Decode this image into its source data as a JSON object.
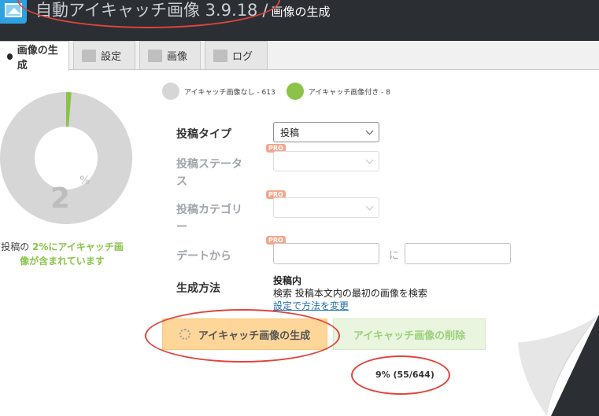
{
  "header": {
    "app_title": "自動アイキャッチ画像 3.9.18",
    "separator": "/",
    "page_name": "画像の生成"
  },
  "tabs": [
    {
      "label": "画像の生成",
      "icon": "dot-icon",
      "active": true
    },
    {
      "label": "設定",
      "icon": "settings-icon",
      "active": false
    },
    {
      "label": "画像",
      "icon": "image-icon",
      "active": false
    },
    {
      "label": "ログ",
      "icon": "log-icon",
      "active": false
    }
  ],
  "chart_data": {
    "type": "pie",
    "categories": [
      "アイキャッチ画像なし",
      "アイキャッチ画像付き"
    ],
    "values": [
      613,
      8
    ],
    "colors": [
      "#d6d6d6",
      "#8bc34a"
    ]
  },
  "donut_center": {
    "value": "2",
    "unit": "%"
  },
  "legend": {
    "without": {
      "label": "アイキャッチ画像なし - 613",
      "color": "#d6d6d6"
    },
    "with": {
      "label": "アイキャッチ画像付き - 8",
      "color": "#8bc34a"
    }
  },
  "summary": {
    "prefix": "投稿の ",
    "highlight": "2%にアイキャッチ画",
    "suffix": "像が含まれています"
  },
  "form": {
    "post_type": {
      "label": "投稿タイプ",
      "value": "投稿"
    },
    "post_status": {
      "label_line1": "投稿ステータ",
      "label_line2": "ス",
      "pro": "PRO"
    },
    "post_category": {
      "label_line1": "投稿カテゴリ",
      "label_line2": "ー",
      "pro": "PRO"
    },
    "date_from": {
      "label": "デートから",
      "pro": "PRO",
      "to": "に"
    },
    "method": {
      "label": "生成方法",
      "title": "投稿内",
      "description": "検索 投稿本文内の最初の画像を検索",
      "link": "設定で方法を変更"
    }
  },
  "buttons": {
    "generate": "アイキャッチ画像の生成",
    "delete": "アイキャッチ画像の削除"
  },
  "progress": {
    "text": "9% (55/644)"
  },
  "colors": {
    "accent_green": "#8bc34a",
    "annotation": "#e0443d",
    "generate_bg": "#ffd699"
  }
}
